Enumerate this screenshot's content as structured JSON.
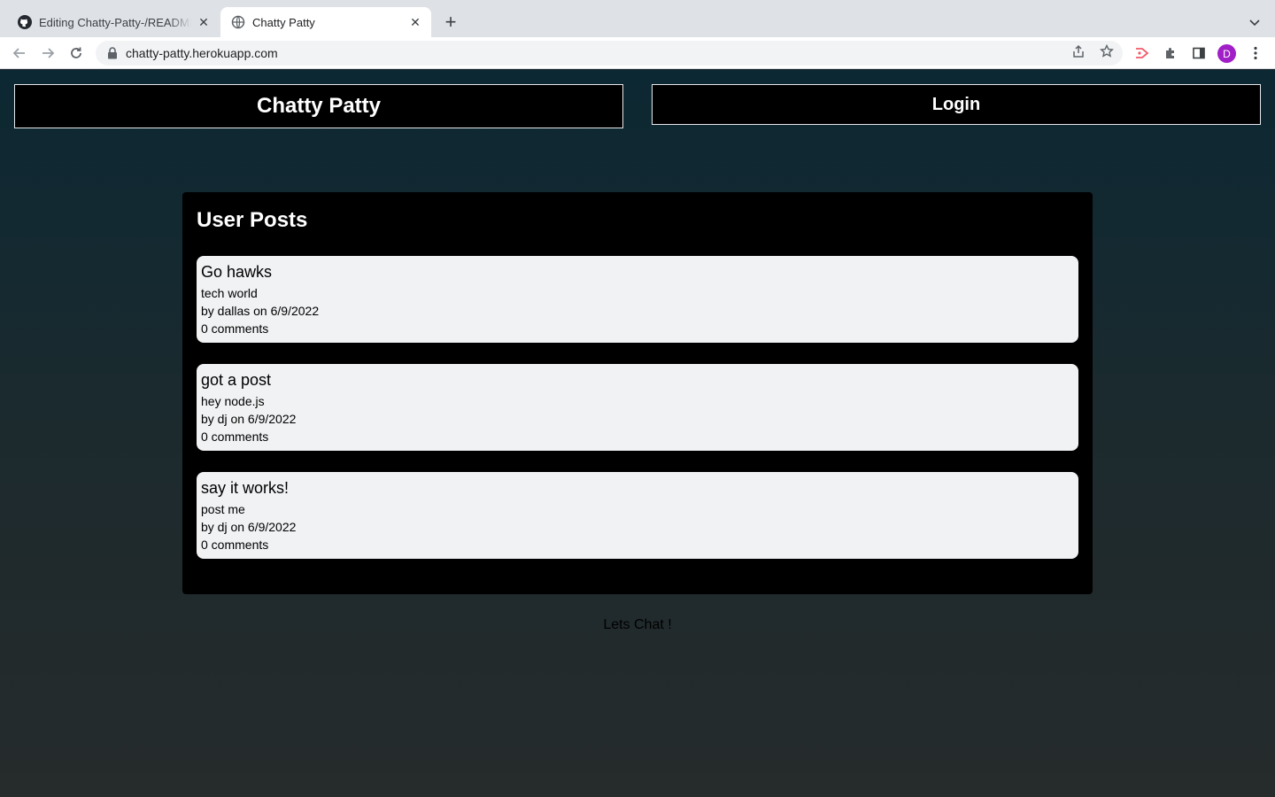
{
  "browser": {
    "tabs": [
      {
        "title": "Editing Chatty-Patty-/README.md",
        "icon": "github-icon",
        "active": false
      },
      {
        "title": "Chatty Patty",
        "icon": "globe-icon",
        "active": true
      }
    ],
    "url": "chatty-patty.herokuapp.com",
    "profile_initial": "D"
  },
  "header": {
    "site_title": "Chatty Patty",
    "login_label": "Login"
  },
  "posts": {
    "heading": "User Posts",
    "items": [
      {
        "title": "Go hawks",
        "body": "tech world",
        "byline": "by dallas on 6/9/2022",
        "comments": "0 comments"
      },
      {
        "title": "got a post",
        "body": "hey node.js",
        "byline": "by dj on 6/9/2022",
        "comments": "0 comments"
      },
      {
        "title": "say it works!",
        "body": "post me",
        "byline": "by dj on 6/9/2022",
        "comments": "0 comments"
      }
    ]
  },
  "footer": {
    "text": "Lets Chat !"
  },
  "colors": {
    "panel": "#000000",
    "card": "#f1f2f4",
    "page_gradient_top": "#0c2833",
    "page_gradient_bottom": "#262b2b"
  }
}
